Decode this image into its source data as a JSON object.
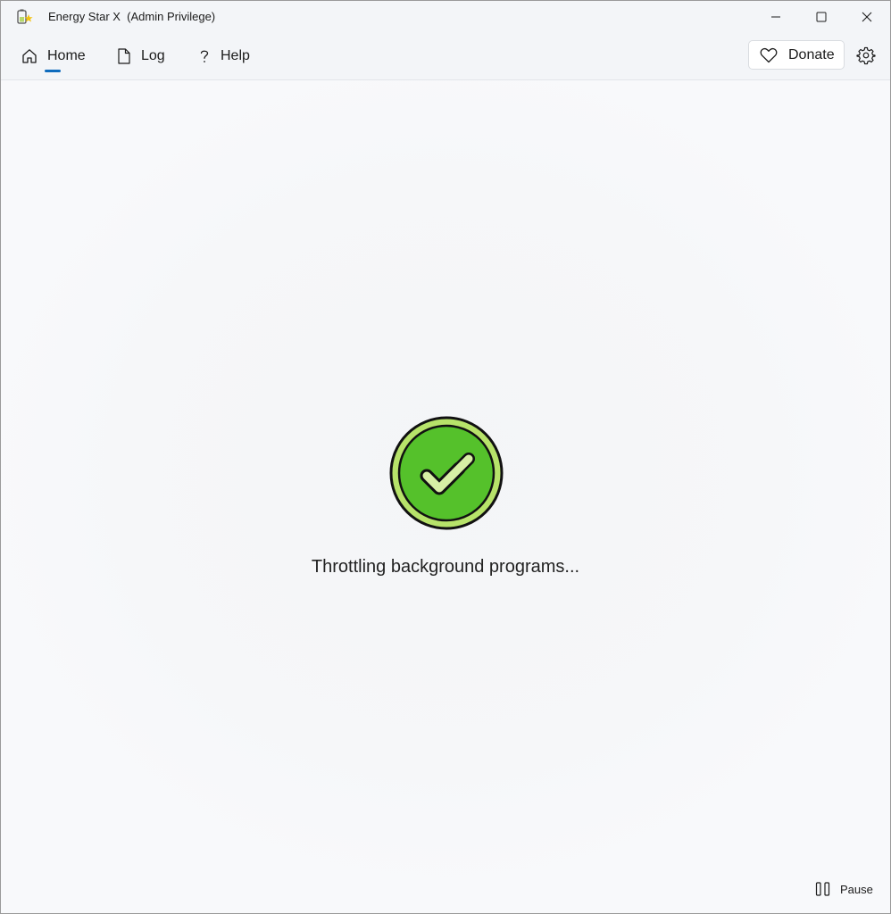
{
  "window": {
    "title": "Energy Star X  (Admin Privilege)",
    "app_icon": "battery-star-icon",
    "controls": [
      "minimize-icon",
      "maximize-icon",
      "close-icon"
    ]
  },
  "nav": {
    "items": [
      {
        "label": "Home",
        "icon": "home-icon",
        "selected": true
      },
      {
        "label": "Log",
        "icon": "document-icon",
        "selected": false
      },
      {
        "label": "Help",
        "icon": "question-icon",
        "selected": false
      }
    ],
    "donate_label": "Donate",
    "donate_icon": "heart-icon",
    "settings_icon": "gear-icon",
    "accent": "#0f6cbd"
  },
  "main": {
    "status_icon": "check-circle-icon",
    "status_color": "#55c12b",
    "status_text": "Throttling background programs..."
  },
  "footer": {
    "pause_label": "Pause",
    "pause_icon": "pause-icon"
  }
}
